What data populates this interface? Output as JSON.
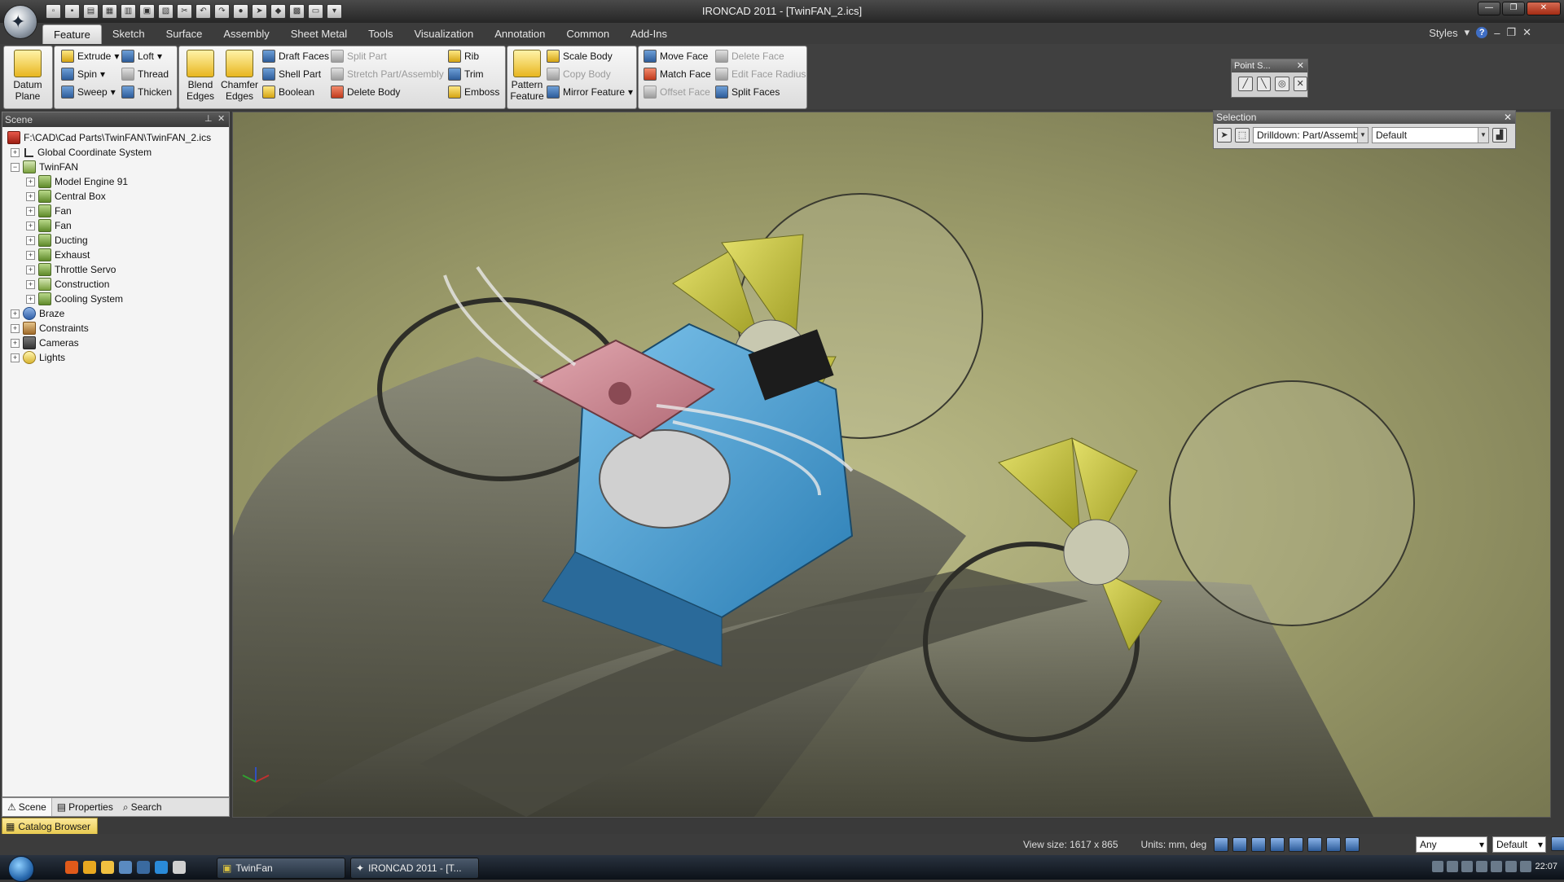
{
  "window": {
    "title": "IRONCAD 2011 - [TwinFAN_2.ics]"
  },
  "tabs": [
    "Feature",
    "Sketch",
    "Surface",
    "Assembly",
    "Sheet Metal",
    "Tools",
    "Visualization",
    "Annotation",
    "Common",
    "Add-Ins"
  ],
  "active_tab": "Feature",
  "styles_label": "Styles",
  "ribbon": {
    "datum_plane": "Datum\nPlane",
    "extrude": "Extrude",
    "loft": "Loft",
    "spin": "Spin",
    "thread": "Thread",
    "sweep": "Sweep",
    "thicken": "Thicken",
    "blend_edges": "Blend\nEdges",
    "chamfer_edges": "Chamfer\nEdges",
    "draft_faces": "Draft Faces",
    "split_part": "Split Part",
    "shell_part": "Shell Part",
    "stretch": "Stretch Part/Assembly",
    "boolean": "Boolean",
    "delete_body": "Delete Body",
    "rib": "Rib",
    "trim": "Trim",
    "emboss": "Emboss",
    "pattern_feature": "Pattern\nFeature",
    "scale_body": "Scale Body",
    "copy_body": "Copy Body",
    "mirror_feature": "Mirror Feature",
    "move_face": "Move Face",
    "delete_face": "Delete Face",
    "match_face": "Match Face",
    "edit_face_radius": "Edit Face Radius",
    "offset_face": "Offset Face",
    "split_faces": "Split Faces"
  },
  "scene": {
    "header": "Scene",
    "root": "F:\\CAD\\Cad Parts\\TwinFAN\\TwinFAN_2.ics",
    "gcs": "Global Coordinate System",
    "assembly": "TwinFAN",
    "children": [
      "Model Engine  91",
      "Central Box",
      "Fan",
      "Fan",
      "Ducting",
      "Exhaust",
      "Throttle Servo",
      "Construction",
      "Cooling System"
    ],
    "braze": "Braze",
    "constraints": "Constraints",
    "cameras": "Cameras",
    "lights": "Lights",
    "footer_tabs": [
      "Scene",
      "Properties",
      "Search"
    ],
    "catalog": "Catalog Browser"
  },
  "point_panel": {
    "title": "Point S..."
  },
  "selection": {
    "title": "Selection",
    "mode": "Drilldown: Part/Assemb",
    "filter": "Default"
  },
  "status": {
    "view_size": "View size: 1617 x 865",
    "units": "Units: mm, deg",
    "combo1": "Any",
    "combo2": "Default"
  },
  "taskbar": {
    "task1": "TwinFan",
    "task2": "IRONCAD 2011 - [T...",
    "clock": "22:07"
  }
}
